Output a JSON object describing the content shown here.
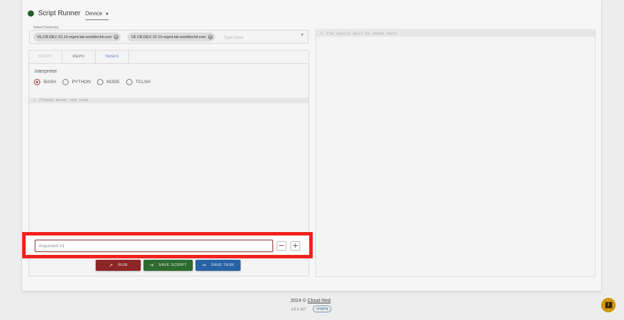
{
  "app": {
    "title": "Script Runner",
    "status_color": "#1f5e26",
    "device_select_label": "Device"
  },
  "device_field": {
    "label": "Select Device(s)",
    "chips": [
      "VE.CR.DEV..01.15-mgmt.lab.worldtechit.com",
      "VE.CR.DEV..02.15-mgmt.lab.worldtechit.com"
    ],
    "placeholder": "Type here"
  },
  "tabs": [
    "SCRIPT",
    "REPO",
    "TASKS"
  ],
  "interpreter": {
    "label": "Interpreter",
    "options": [
      "BASH",
      "PYTHON",
      "NODE",
      "TCLSH"
    ],
    "selected": "BASH"
  },
  "editor": {
    "line_number": "1",
    "placeholder_text": "Please enter the code."
  },
  "result": {
    "line_number": "1",
    "placeholder_text": "The result will be shown here"
  },
  "argument": {
    "placeholder": "Argument #1",
    "minus_label": "−",
    "plus_label": "+",
    "highlight_color": "#f0221c"
  },
  "actions": {
    "run_label": "RUN",
    "save_script_label": "SAVE SCRIPT",
    "save_task_label": "SAVE TASK"
  },
  "footer": {
    "year": "2024",
    "copyright": "©",
    "brand": "Cloud Red",
    "version": "v.2.1.117",
    "env_badge": "staging"
  },
  "fab": {
    "icon": "feedback-icon",
    "color": "#d4950e"
  }
}
